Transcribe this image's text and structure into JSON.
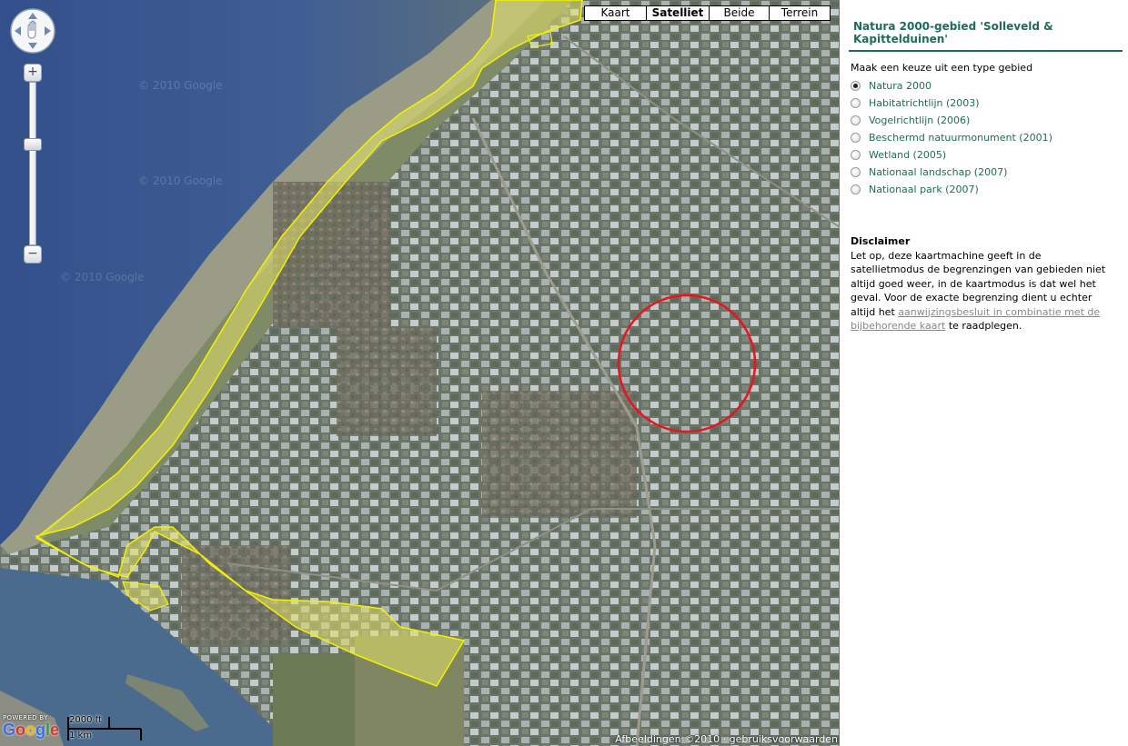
{
  "map": {
    "map_types": [
      {
        "label": "Kaart",
        "active": false
      },
      {
        "label": "Satelliet",
        "active": true
      },
      {
        "label": "Beide",
        "active": false
      },
      {
        "label": "Terrein",
        "active": false
      }
    ],
    "watermark": "© 2010 Google",
    "logo_powered_by": "POWERED BY",
    "logo_text": "Google",
    "scale_imperial": "2000 ft",
    "scale_metric": "1 km",
    "copyright_text": "Afbeeldingen ©2010 ·",
    "terms_link": "gebruiksvoorwaarden",
    "zoom_in_label": "+",
    "zoom_out_label": "−",
    "colors": {
      "sea": "#3d5a8f",
      "natura_polygon_outline": "#f2f200",
      "natura_polygon_fill": "#e6e36a",
      "highlight_circle": "#e8141e"
    }
  },
  "panel": {
    "title": "Natura 2000-gebied 'Solleveld & Kapittelduinen'",
    "choose_label": "Maak een keuze uit een type gebied",
    "options": [
      {
        "label": "Natura 2000",
        "checked": true
      },
      {
        "label": "Habitatrichtlijn (2003)",
        "checked": false
      },
      {
        "label": "Vogelrichtlijn (2006)",
        "checked": false
      },
      {
        "label": "Beschermd natuurmonument (2001)",
        "checked": false
      },
      {
        "label": "Wetland (2005)",
        "checked": false
      },
      {
        "label": "Nationaal landschap (2007)",
        "checked": false
      },
      {
        "label": "Nationaal park (2007)",
        "checked": false
      }
    ],
    "disclaimer": {
      "heading": "Disclaimer",
      "text_before": "Let op, deze kaartmachine geeft in de satellietmodus de begrenzingen van gebieden niet altijd goed weer, in de kaartmodus is dat wel het geval. Voor de exacte begrenzing dient u echter altijd het",
      "link_text": "aanwijzingsbesluit in combinatie met de bijbehorende kaart",
      "text_after": "te raadplegen."
    },
    "colors": {
      "accent": "#1f6b5a"
    }
  }
}
